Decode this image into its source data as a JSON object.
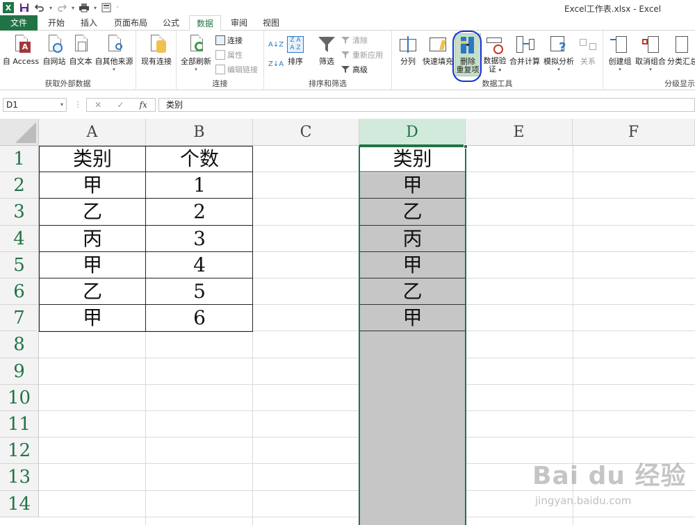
{
  "window": {
    "title": "Excel工作表.xlsx - Excel"
  },
  "tabs": [
    "文件",
    "开始",
    "插入",
    "页面布局",
    "公式",
    "数据",
    "审阅",
    "视图"
  ],
  "active_tab": "数据",
  "ribbon": {
    "groups": {
      "external": {
        "label": "获取外部数据",
        "buttons": [
          "自 Access",
          "自网站",
          "自文本",
          "自其他来源"
        ]
      },
      "existing": {
        "label": "现有连接"
      },
      "connections": {
        "label": "连接",
        "refresh": "全部刷新",
        "items": [
          "连接",
          "属性",
          "编辑链接"
        ]
      },
      "sort_filter": {
        "label": "排序和筛选",
        "sort": "排序",
        "filter": "筛选",
        "items": [
          "清除",
          "重新应用",
          "高级"
        ]
      },
      "data_tools": {
        "label": "数据工具",
        "buttons": [
          "分列",
          "快速填充",
          "删除",
          "重复项",
          "数据验",
          "证",
          "合并计算",
          "模拟分析",
          "关系"
        ]
      },
      "outline": {
        "label": "分级显示",
        "buttons": [
          "创建组",
          "取消组合",
          "分类汇总"
        ]
      }
    }
  },
  "formula_bar": {
    "name_box": "D1",
    "fx": "fx",
    "content": "类别"
  },
  "sheet": {
    "columns": [
      "A",
      "B",
      "C",
      "D",
      "E",
      "F"
    ],
    "rows": [
      "1",
      "2",
      "3",
      "4",
      "5",
      "6",
      "7",
      "8",
      "9",
      "10",
      "11",
      "12",
      "13",
      "14"
    ],
    "table_ab": [
      [
        "类别",
        "个数"
      ],
      [
        "甲",
        "1"
      ],
      [
        "乙",
        "2"
      ],
      [
        "丙",
        "3"
      ],
      [
        "甲",
        "4"
      ],
      [
        "乙",
        "5"
      ],
      [
        "甲",
        "6"
      ]
    ],
    "col_d": [
      "类别",
      "甲",
      "乙",
      "丙",
      "甲",
      "乙",
      "甲"
    ]
  },
  "watermark": {
    "main": "Bai du 经验",
    "sub": "jingyan.baidu.com"
  },
  "colors": {
    "excel_green": "#217346",
    "selection_fill": "#c6c6c6",
    "annotation_blue": "#1a2fd8"
  }
}
